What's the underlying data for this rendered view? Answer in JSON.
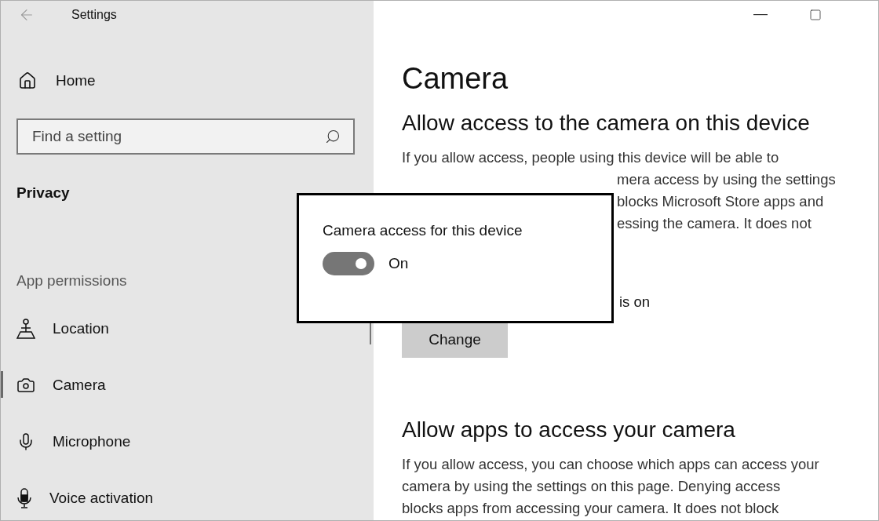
{
  "window": {
    "title": "Settings",
    "controls": [
      {
        "kind": "minimize"
      },
      {
        "kind": "maximize"
      }
    ]
  },
  "sidebar": {
    "home": "Home",
    "search": {
      "placeholder": "Find a setting"
    },
    "section": "Privacy",
    "group": "App permissions",
    "items": [
      {
        "label": "Location",
        "kind": "location",
        "selected": false
      },
      {
        "label": "Camera",
        "kind": "camera",
        "selected": true
      },
      {
        "label": "Microphone",
        "kind": "microphone",
        "selected": false
      },
      {
        "label": "Voice activation",
        "kind": "voice",
        "selected": false
      }
    ]
  },
  "content": {
    "title": "Camera",
    "section1": {
      "heading": "Allow access to the camera on this device",
      "lines": [
        {
          "kind": "full",
          "text": "If you allow access, people using this device will be able to"
        },
        {
          "kind": "partial",
          "text": "mera access by using the settings"
        },
        {
          "kind": "partial",
          "text": "blocks Microsoft Store apps and"
        },
        {
          "kind": "partial",
          "text": "essing the camera. It does not"
        }
      ],
      "status": "is on",
      "button": "Change"
    },
    "section2": {
      "heading": "Allow apps to access your camera",
      "lines": [
        "If you allow access, you can choose which apps can access your",
        "camera by using the settings on this page. Denying access",
        "blocks apps from accessing your camera. It does not block"
      ]
    }
  },
  "popup": {
    "label": "Camera access for this device",
    "toggle": {
      "on": true,
      "text": "On"
    }
  }
}
